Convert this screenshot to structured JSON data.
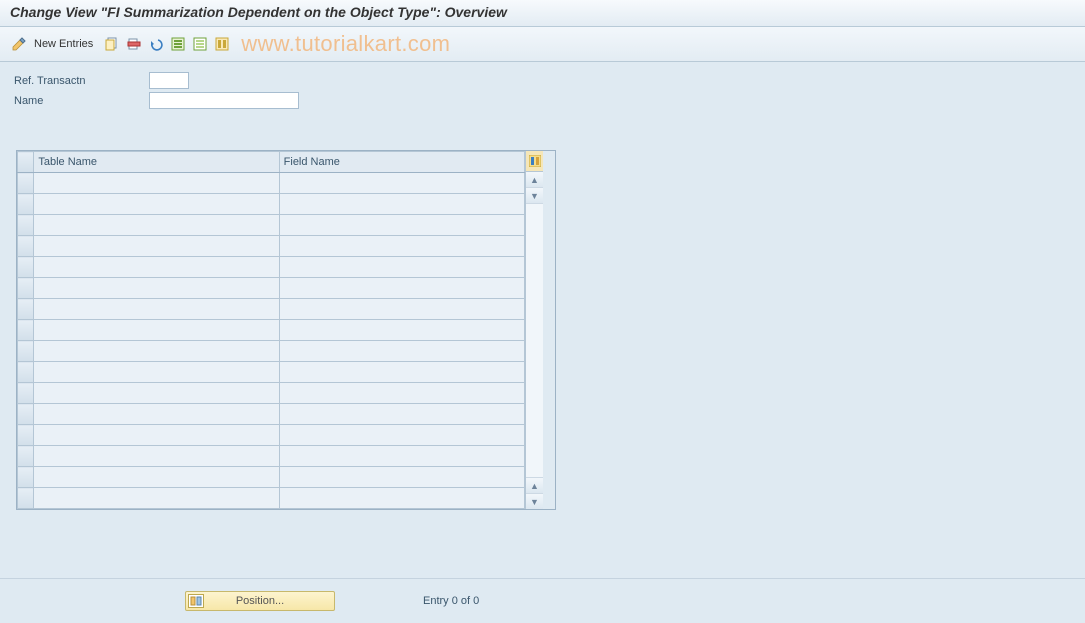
{
  "title": "Change View \"FI Summarization Dependent on the Object Type\": Overview",
  "toolbar": {
    "new_entries_label": "New Entries"
  },
  "watermark": "www.tutorialkart.com",
  "form": {
    "ref_transactn_label": "Ref. Transactn",
    "ref_transactn_value": "",
    "name_label": "Name",
    "name_value": ""
  },
  "table": {
    "col_table_name": "Table Name",
    "col_field_name": "Field Name",
    "row_count": 16
  },
  "footer": {
    "position_label": "Position...",
    "entry_text": "Entry 0 of 0"
  }
}
